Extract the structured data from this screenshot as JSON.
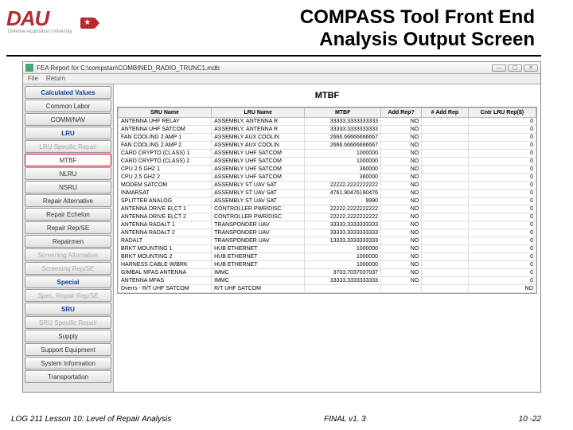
{
  "page": {
    "logo_text": "DAU",
    "logo_sub": "Defense Acquisition University",
    "title_line1": "COMPASS Tool Front End",
    "title_line2": "Analysis Output Screen"
  },
  "window": {
    "title": "FEA Report for C:\\compstan\\COMBINED_RADIO_TRUNC1.mdb",
    "menu": {
      "file": "File",
      "return": "Return"
    }
  },
  "content_title": "MTBF",
  "sidebar": [
    {
      "label": "Calculated Values",
      "style": "blue"
    },
    {
      "label": "Common Labor",
      "style": ""
    },
    {
      "label": "COMM/NAV",
      "style": ""
    },
    {
      "label": "LRU",
      "style": "blue"
    },
    {
      "label": "LRU Specific Repair",
      "style": "dis"
    },
    {
      "label": "MTBF",
      "style": "sel"
    },
    {
      "label": "NLRU",
      "style": ""
    },
    {
      "label": "NSRU",
      "style": ""
    },
    {
      "label": "Repair Alternative",
      "style": ""
    },
    {
      "label": "Repair Echelon",
      "style": ""
    },
    {
      "label": "Repair Rep/SE",
      "style": ""
    },
    {
      "label": "Repairmen",
      "style": ""
    },
    {
      "label": "Screening Alternative",
      "style": "dis"
    },
    {
      "label": "Screening Rep/SE",
      "style": "dis"
    },
    {
      "label": "Special",
      "style": "blue"
    },
    {
      "label": "Spec. Repair Rep/SE",
      "style": "dis"
    },
    {
      "label": "SRU",
      "style": "blue"
    },
    {
      "label": "SRU Specific Repair",
      "style": "dis"
    },
    {
      "label": "Supply",
      "style": ""
    },
    {
      "label": "Support Equipment",
      "style": ""
    },
    {
      "label": "System Information",
      "style": ""
    },
    {
      "label": "Transportation",
      "style": ""
    }
  ],
  "columns": [
    "SRU Name",
    "LRU Name",
    "MTBF",
    "Add Rep?",
    "# Add Rep",
    "Cntr LRU Rep($)"
  ],
  "rows": [
    [
      "ANTENNA UHF RELAY",
      "ASSEMBLY, ANTENNA R",
      "33333.3333333333",
      "NO",
      "",
      "0"
    ],
    [
      "ANTENNA UHF SATCOM",
      "ASSEMBLY, ANTENNA R",
      "33333.3333333333",
      "NO",
      "",
      "0"
    ],
    [
      "FAN COOLING 2 AMP 1",
      "ASSEMBLY AUX COOLIN",
      "2666.66666666667",
      "NO",
      "",
      "0"
    ],
    [
      "FAN COOLING 2 AMP 2",
      "ASSEMBLY AUX COOLIN",
      "2666.66666666667",
      "NO",
      "",
      "0"
    ],
    [
      "CARD CRYPTO (CLASS) 1",
      "ASSEMBLY UHF SATCOM",
      "1000000",
      "NO",
      "",
      "0"
    ],
    [
      "CARD CRYPTO (CLASS) 2",
      "ASSEMBLY UHF SATCOM",
      "1000000",
      "NO",
      "",
      "0"
    ],
    [
      "CPU 2.5 GHZ 1",
      "ASSEMBLY UHF SATCOM",
      "360000",
      "NO",
      "",
      "0"
    ],
    [
      "CPU 2.5 GHZ 2",
      "ASSEMBLY UHF SATCOM",
      "360000",
      "NO",
      "",
      "0"
    ],
    [
      "MODEM SATCOM",
      "ASSEMBLY ST UAV SAT",
      "22222.2222222222",
      "NO",
      "",
      "0"
    ],
    [
      "INMARSAT",
      "ASSEMBLY ST UAV SAT",
      "4761.90476190476",
      "NO",
      "",
      "0"
    ],
    [
      "SPLITTER ANALOG",
      "ASSEMBLY ST UAV SAT",
      "9990",
      "NO",
      "",
      "0"
    ],
    [
      "ANTENNA DRIVE ELCT 1",
      "CONTROLLER PWR/DISC",
      "22222.2222222222",
      "NO",
      "",
      "0"
    ],
    [
      "ANTENNA DRIVE ELCT 2",
      "CONTROLLER PWR/DISC",
      "22222.2222222222",
      "NO",
      "",
      "0"
    ],
    [
      "ANTENNA RADALT 1",
      "TRANSPONDER UAV",
      "33333.3333333333",
      "NO",
      "",
      "0"
    ],
    [
      "ANTENNA RADALT 2",
      "TRANSPONDER UAV",
      "33333.3333333333",
      "NO",
      "",
      "0"
    ],
    [
      "RADALT",
      "TRANSPONDER UAV",
      "13333.3333333333",
      "NO",
      "",
      "0"
    ],
    [
      "BRKT MOUNTING 1",
      "HUB ETHERNET",
      "1000000",
      "NO",
      "",
      "0"
    ],
    [
      "BRKT MOUNTING 2",
      "HUB ETHERNET",
      "1000000",
      "NO",
      "",
      "0"
    ],
    [
      "HARNESS CABLE W/BRK",
      "HUB ETHERNET",
      "1000000",
      "NO",
      "",
      "0"
    ],
    [
      "GIMBAL MFAS ANTENNA",
      "IMMC",
      "3703.7037037037",
      "NO",
      "",
      "0"
    ],
    [
      "ANTENNA MFAS",
      "IMMC",
      "33333.3333333333",
      "NO",
      "",
      "0"
    ],
    [
      "Dverrs - R/T UHF SATCOM",
      "R/T UHF SATCOM",
      "",
      "",
      "",
      "NO"
    ]
  ],
  "footer": {
    "left": "LOG 211 Lesson 10: Level of Repair Analysis",
    "center": "FINAL v1. 3",
    "right": "10 -22"
  }
}
